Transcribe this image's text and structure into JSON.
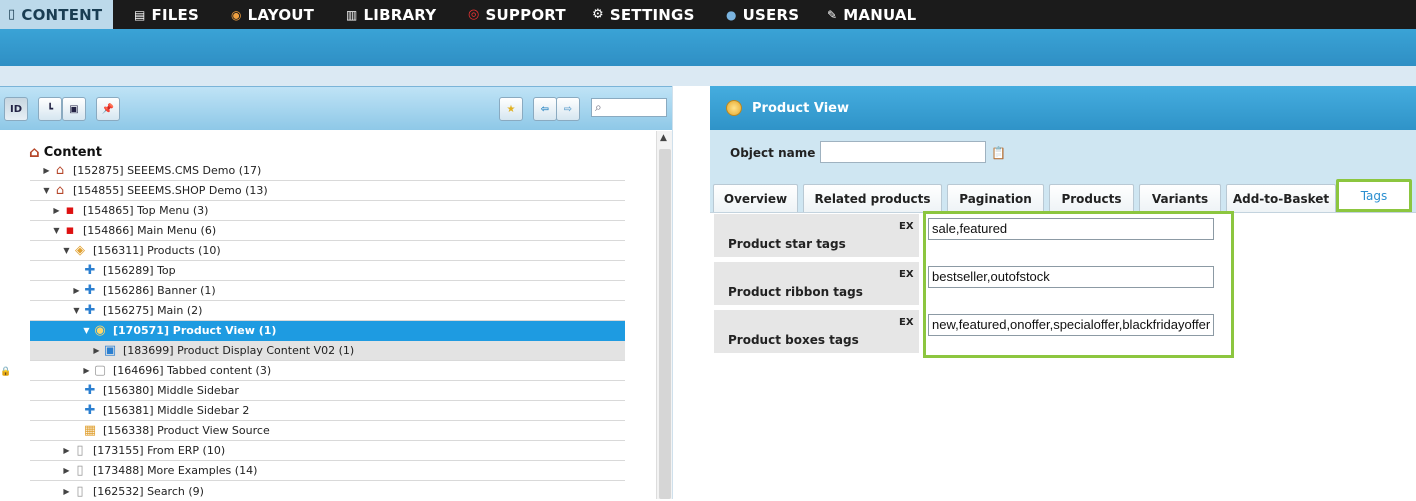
{
  "nav": {
    "items": [
      {
        "label": "CONTENT",
        "icon": "document-icon",
        "active": true
      },
      {
        "label": "FILES",
        "icon": "file-icon",
        "active": false
      },
      {
        "label": "LAYOUT",
        "icon": "palette-icon",
        "active": false
      },
      {
        "label": "LIBRARY",
        "icon": "book-icon",
        "active": false
      },
      {
        "label": "SUPPORT",
        "icon": "lifebuoy-icon",
        "active": false
      },
      {
        "label": "SETTINGS",
        "icon": "gear-icon",
        "active": false
      },
      {
        "label": "USERS",
        "icon": "user-icon",
        "active": false
      },
      {
        "label": "MANUAL",
        "icon": "notepad-icon",
        "active": false
      }
    ]
  },
  "toolbar": {
    "id_label": "ID"
  },
  "tree": {
    "root_label": "Content",
    "rows": [
      "[152875] SEEEMS.CMS Demo (17)",
      "[154855] SEEEMS.SHOP Demo (13)",
      "[154865] Top Menu (3)",
      "[154866] Main Menu (6)",
      "[156311] Products (10)",
      "[156289] Top",
      "[156286] Banner (1)",
      "[156275] Main (2)",
      "[170571] Product View (1)",
      "[183699] Product Display Content V02 (1)",
      "[164696] Tabbed content (3)",
      "[156380] Middle Sidebar",
      "[156381] Middle Sidebar 2",
      "[156338] Product View Source",
      "[173155] From ERP (10)",
      "[173488] More Examples (14)",
      "[162532] Search (9)"
    ]
  },
  "panel": {
    "title": "Product View",
    "object_name_label": "Object name",
    "object_name_value": "",
    "tabs": [
      "Overview",
      "Related products",
      "Pagination",
      "Products",
      "Variants",
      "Add-to-Basket",
      "Tags"
    ],
    "active_tab": "Tags",
    "fields": [
      {
        "label": "Product star tags",
        "ex": "EX",
        "value": "sale,featured"
      },
      {
        "label": "Product ribbon tags",
        "ex": "EX",
        "value": "bestseller,outofstock"
      },
      {
        "label": "Product boxes tags",
        "ex": "EX",
        "value": "new,featured,onoffer,specialoffer,blackfridayoffer"
      }
    ]
  },
  "colors": {
    "accent": "#1e9be1",
    "highlight_border": "#8cc63f",
    "nav_bg": "#1b1b1b"
  }
}
